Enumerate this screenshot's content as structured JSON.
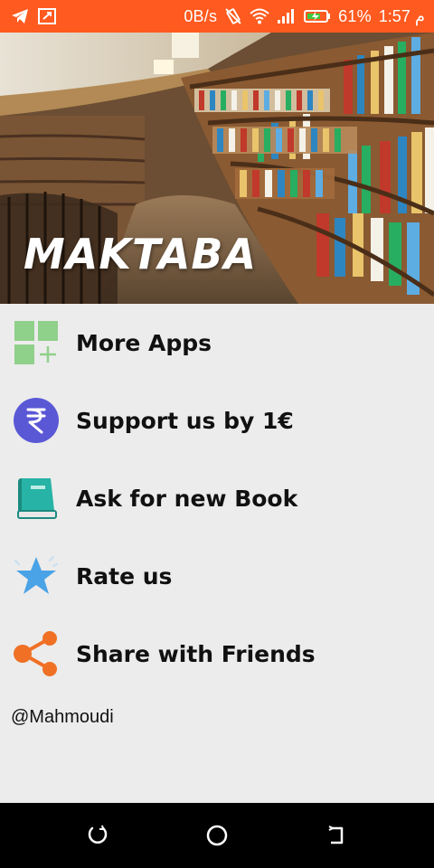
{
  "status_bar": {
    "network_speed": "0B/s",
    "battery": "61%",
    "time": "1:57 م"
  },
  "header": {
    "title": "MAKTABA"
  },
  "menu": {
    "items": [
      {
        "label": "More Apps",
        "icon": "apps-grid-icon"
      },
      {
        "label": "Support us by 1€",
        "icon": "rupee-coin-icon"
      },
      {
        "label": "Ask for new Book",
        "icon": "book-icon"
      },
      {
        "label": "Rate us",
        "icon": "star-icon"
      },
      {
        "label": "Share with Friends",
        "icon": "share-icon"
      }
    ]
  },
  "credit": "@Mahmoudi",
  "colors": {
    "status_bar": "#ff5a1f",
    "background": "#ececec",
    "rupee": "#5b58d6",
    "book": "#27b3a5",
    "star": "#4aa3e6",
    "share": "#f07025",
    "apps": "#8fd08a"
  }
}
